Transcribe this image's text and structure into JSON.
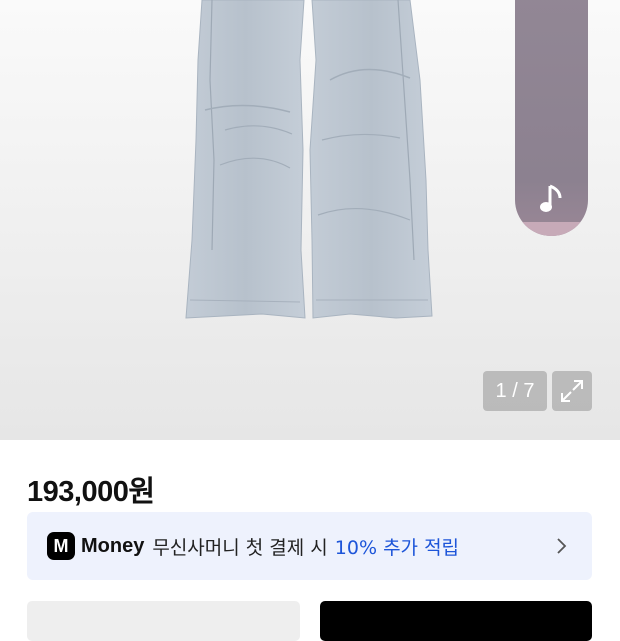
{
  "gallery": {
    "image_alt": "light blue cargo pants",
    "counter_current": "1",
    "counter_total": "7",
    "counter_text": "1 / 7"
  },
  "product": {
    "price": "193,000원"
  },
  "promo": {
    "logo_letter": "M",
    "brand": "Money",
    "text": "무신사머니 첫 결제 시",
    "highlight": "10% 추가 적립"
  },
  "colors": {
    "accent": "#1d55d9",
    "banner_bg": "#eef2fd",
    "pill": "#8c8190"
  },
  "icons": [
    "music-note-icon",
    "expand-icon",
    "chevron-right-icon"
  ]
}
